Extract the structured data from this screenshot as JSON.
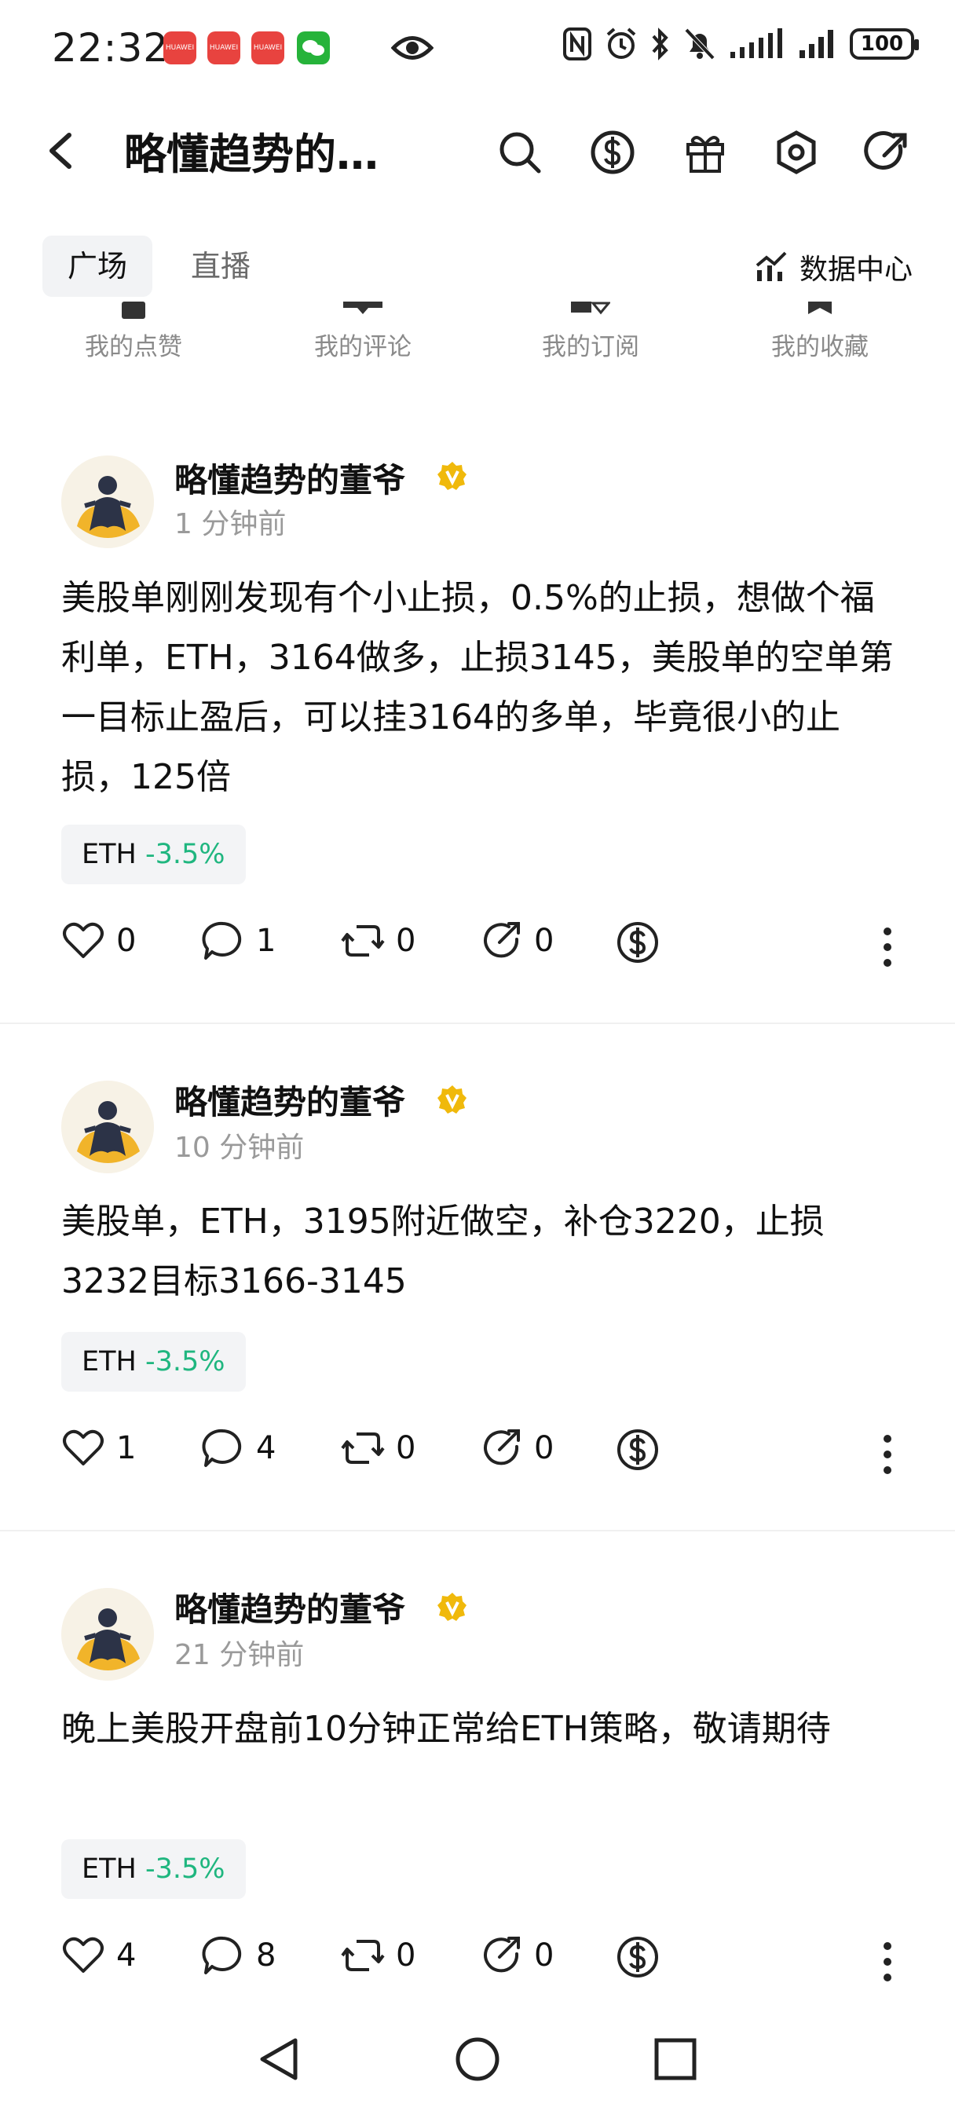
{
  "status": {
    "time": "22:32",
    "battery": "100",
    "app_badge": "HUAWEI"
  },
  "header": {
    "title": "略懂趋势的…",
    "icons": [
      "search-icon",
      "dollar-icon",
      "gift-icon",
      "hexagon-settings-icon",
      "share-icon"
    ]
  },
  "tabs": {
    "plaza": "广场",
    "live": "直播",
    "data_center": "数据中心"
  },
  "quick": {
    "likes": "我的点赞",
    "comments": "我的评论",
    "subscriptions": "我的订阅",
    "favorites": "我的收藏"
  },
  "posts": [
    {
      "author": "略懂趋势的董爷",
      "time": "1 分钟前",
      "content": "美股单刚刚发现有个小止损，0.5%的止损，想做个福利单，ETH，3164做多，止损3145，美股单的空单第一目标止盈后，可以挂3164的多单，毕竟很小的止损，125倍",
      "tag": {
        "symbol": "ETH",
        "change": "-3.5%"
      },
      "likes": "0",
      "comments": "1",
      "reposts": "0",
      "shares": "0"
    },
    {
      "author": "略懂趋势的董爷",
      "time": "10 分钟前",
      "content": "美股单，ETH，3195附近做空，补仓3220，止损3232目标3166-3145",
      "tag": {
        "symbol": "ETH",
        "change": "-3.5%"
      },
      "likes": "1",
      "comments": "4",
      "reposts": "0",
      "shares": "0"
    },
    {
      "author": "略懂趋势的董爷",
      "time": "21 分钟前",
      "content": "晚上美股开盘前10分钟正常给ETH策略，敬请期待",
      "tag": {
        "symbol": "ETH",
        "change": "-3.5%"
      },
      "likes": "4",
      "comments": "8",
      "reposts": "0",
      "shares": "0"
    }
  ],
  "colors": {
    "accent_green": "#1fb67f",
    "verified_gold": "#f0b90b"
  }
}
